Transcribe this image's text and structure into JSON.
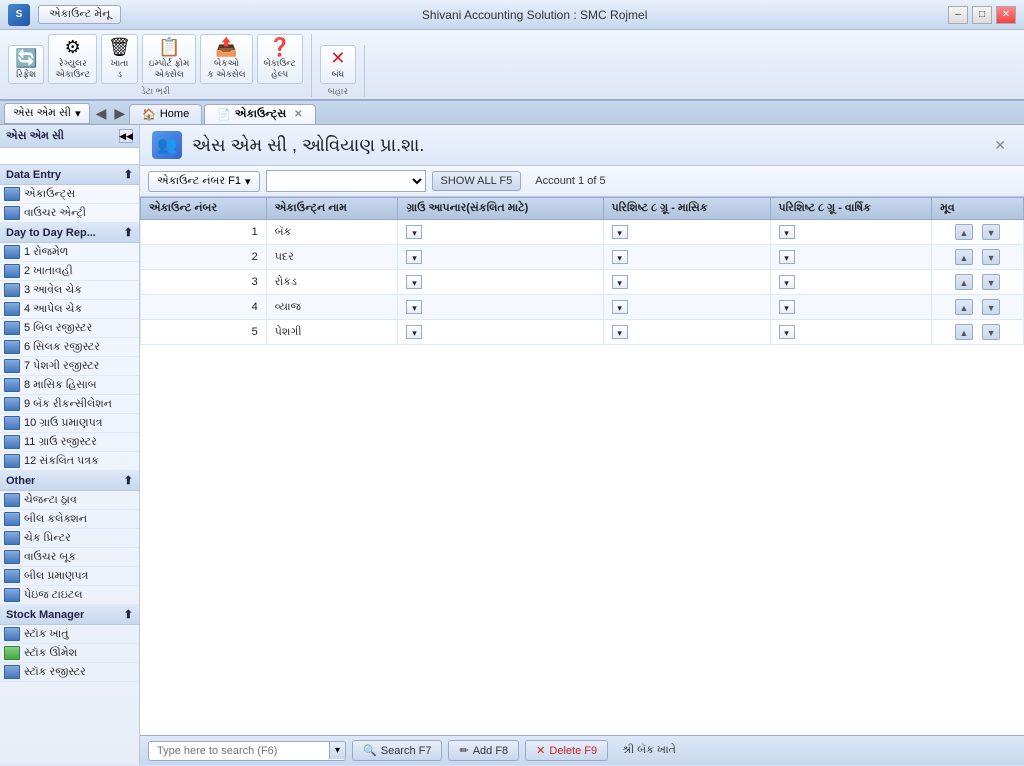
{
  "titleBar": {
    "logoText": "S",
    "menuBtn": "એકાઉન્ટ મેનૂ",
    "title": "Shivani Accounting Solution : SMC Rojmel",
    "minBtn": "–",
    "maxBtn": "□",
    "closeBtn": "✕"
  },
  "ribbon": {
    "groups": [
      {
        "label": "ડેટા ભરી",
        "items": [
          {
            "icon": "🔄",
            "label": "રિફ્રેશ"
          },
          {
            "icon": "⚙",
            "label": "રેગ્યુલર\nએકાઉન્ટ"
          },
          {
            "icon": "🗑",
            "label": "ખાતા\nડ"
          },
          {
            "icon": "📋",
            "label": "ઇમ્પોર્ટ ફ્રોમ\nએક્સેલ"
          },
          {
            "icon": "📤",
            "label": "બેકઓ\nક એક્સેલ"
          },
          {
            "icon": "❓",
            "label": "બેકાઉન્ટ\nહેલ્પ"
          }
        ]
      },
      {
        "label": "બહાર",
        "items": [
          {
            "icon": "✕",
            "label": "બંધ",
            "isClose": true
          }
        ]
      }
    ]
  },
  "nav": {
    "sidebarTitle": "એસ એમ સી",
    "tabs": [
      {
        "label": "Home",
        "active": false
      },
      {
        "label": "એકાઉન્ટ્સ",
        "active": true,
        "closable": true
      }
    ]
  },
  "sidebar": {
    "placeholder": "",
    "sections": [
      {
        "title": "Data Entry",
        "items": [
          {
            "label": "એકાઉન્ટ્સ",
            "iconType": "blue"
          },
          {
            "label": "વાઉચર એન્ટ્રી",
            "iconType": "blue"
          }
        ]
      },
      {
        "title": "Day to Day Rep...",
        "items": [
          {
            "label": "1 રોજમેળ",
            "iconType": "blue"
          },
          {
            "label": "2 ખાતાવહી",
            "iconType": "blue"
          },
          {
            "label": "3 આવેલ ચેક",
            "iconType": "blue"
          },
          {
            "label": "4 આપેલ ચેક",
            "iconType": "blue"
          },
          {
            "label": "5 બિલ રજીસ્ટર",
            "iconType": "blue"
          },
          {
            "label": "6 સિલક રજીસ્ટર",
            "iconType": "blue"
          },
          {
            "label": "7 પેશગી રજીસ્ટર",
            "iconType": "blue"
          },
          {
            "label": "8 માસિક હિસાબ",
            "iconType": "blue"
          },
          {
            "label": "9 બેંક રીકન્સીલેશન",
            "iconType": "blue"
          },
          {
            "label": "10 ગ્રાઉ પ્રમાણપત્ર",
            "iconType": "blue"
          },
          {
            "label": "11 ગ્રાઉ રજીસ્ટર",
            "iconType": "blue"
          },
          {
            "label": "12 સંકલિત પત્રક",
            "iconType": "blue"
          }
        ]
      },
      {
        "title": "Other",
        "items": [
          {
            "label": "ચેજન્ટા ઠ્રાવ",
            "iconType": "blue"
          },
          {
            "label": "બીલ કલેક્શન",
            "iconType": "blue"
          },
          {
            "label": "ચેક પ્રિન્ટર",
            "iconType": "blue"
          },
          {
            "label": "વાઉચર બૂક",
            "iconType": "blue"
          },
          {
            "label": "બીલ પ્રમાણપત્ર",
            "iconType": "blue"
          },
          {
            "label": "પેઇજ ટાઇટલ",
            "iconType": "blue"
          }
        ]
      },
      {
        "title": "Stock Manager",
        "items": [
          {
            "label": "સ્ટૉક ખાતું",
            "iconType": "blue"
          },
          {
            "label": "સ્ટૉક ઊંમેશ",
            "iconType": "green"
          },
          {
            "label": "સ્ટૉક રજીસ્ટર",
            "iconType": "blue"
          }
        ]
      }
    ]
  },
  "content": {
    "title": "એસ એમ સી  , ઓવિયાણ પ્રા.શા.",
    "accountLabel": "એકાઉન્ટ નંબર F1",
    "showAllBtn": "SHOW ALL F5",
    "accountInfo": "Account 1 of 5",
    "tableHeaders": [
      "એકાઉન્ટ નંબર",
      "એકાઉન્ટ્ન નામ",
      "ગ્રાઉ આપનાર(સંકલિત માટે)",
      "પરિશિષ્ટ ૮ ગ્રૂ - માસિક",
      "પરિશિષ્ટ ૮ ગ્રૂ - વાર્ષિક",
      "મૂવ"
    ],
    "rows": [
      {
        "num": "1",
        "name": "બૅક",
        "grau": "",
        "monthly": "",
        "yearly": ""
      },
      {
        "num": "2",
        "name": "૫દર",
        "grau": "",
        "monthly": "",
        "yearly": ""
      },
      {
        "num": "3",
        "name": "રોકડ",
        "grau": "",
        "monthly": "",
        "yearly": ""
      },
      {
        "num": "4",
        "name": "વ્યાજ",
        "grau": "",
        "monthly": "",
        "yearly": ""
      },
      {
        "num": "5",
        "name": "પેશગી",
        "grau": "",
        "monthly": "",
        "yearly": ""
      }
    ]
  },
  "bottomBar": {
    "searchPlaceholder": "Type here to search (F6)",
    "searchBtn": "🔍 Search F7",
    "addBtn": "✏ Add F8",
    "deleteBtn": "✕ Delete F9",
    "statusLabel": "શ્રી બૅક ખાતે"
  }
}
